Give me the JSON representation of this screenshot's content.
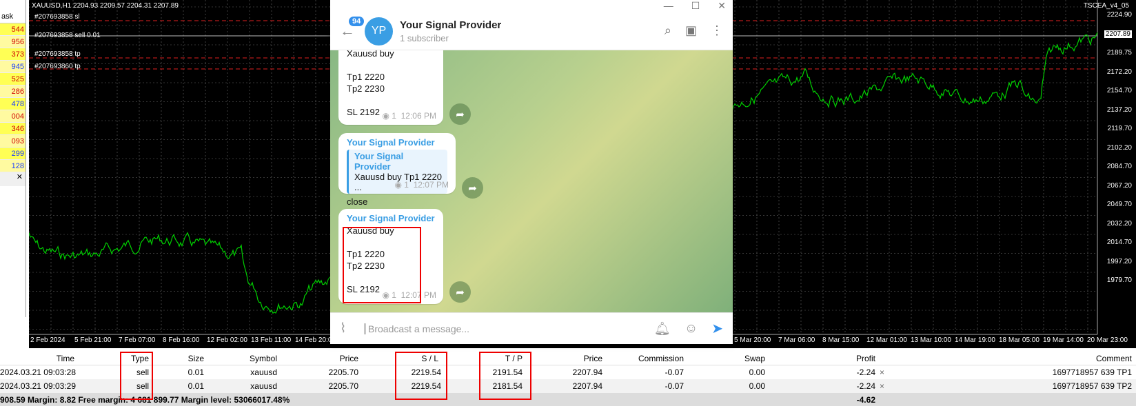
{
  "market_watch": {
    "header": "ask",
    "values": [
      "544",
      "956",
      "373",
      "945",
      "525",
      "286",
      "478",
      "004",
      "346",
      "093",
      "299",
      "128"
    ],
    "colors": [
      "#d10000",
      "#d10000",
      "#d10000",
      "#1a3cff",
      "#d10000",
      "#d10000",
      "#1a3cff",
      "#d10000",
      "#d10000",
      "#d10000",
      "#1a3cff",
      "#1a3cff"
    ]
  },
  "chart": {
    "title": "XAUUSD,H1  2204.93 2209.57 2204.31 2207.89",
    "ea_label": "TSCEA_v4_05",
    "order_lines": [
      "#207693858 sl",
      "#207693858 sell 0.01",
      "#207693858 tp",
      "#207693860 tp"
    ],
    "prices": [
      "2224.90",
      "2207.89",
      "2189.75",
      "2172.20",
      "2154.70",
      "2137.20",
      "2119.70",
      "2102.20",
      "2084.70",
      "2067.20",
      "2049.70",
      "2032.20",
      "2014.70",
      "1997.20",
      "1979.70"
    ],
    "dates_left": [
      "2 Feb 2024",
      "5 Feb 21:00",
      "7 Feb 07:00",
      "8 Feb 16:00",
      "12 Feb 02:00",
      "13 Feb 11:00",
      "14 Feb 20:00"
    ],
    "dates_right": [
      "5 Mar 20:00",
      "7 Mar 06:00",
      "8 Mar 15:00",
      "12 Mar 01:00",
      "13 Mar 10:00",
      "14 Mar 19:00",
      "18 Mar 05:00",
      "19 Mar 14:00",
      "20 Mar 23:00"
    ]
  },
  "telegram": {
    "badge": "94",
    "avatar": "YP",
    "channel_name": "Your Signal Provider",
    "subscribers": "1 subscriber",
    "input_placeholder": "Broadcast a message...",
    "msg1": {
      "lines": [
        "Xauusd buy",
        "",
        "Tp1 2220",
        "Tp2 2230",
        "",
        "SL 2192"
      ],
      "views": "1",
      "time": "12:06 PM"
    },
    "msg2": {
      "sender": "Your Signal Provider",
      "quote_name": "Your Signal Provider",
      "quote_text": "Xauusd buy  Tp1 2220 ...",
      "text": "close",
      "views": "1",
      "time": "12:07 PM"
    },
    "msg3": {
      "sender": "Your Signal Provider",
      "lines": [
        "Xauusd buy",
        "",
        "Tp1 2220",
        "Tp2 2230",
        "",
        "SL 2192"
      ],
      "views": "1",
      "time": "12:07 PM"
    }
  },
  "terminal": {
    "headers": {
      "time": "Time",
      "type": "Type",
      "size": "Size",
      "symbol": "Symbol",
      "price": "Price",
      "sl": "S / L",
      "tp": "T / P",
      "price2": "Price",
      "commission": "Commission",
      "swap": "Swap",
      "profit": "Profit",
      "comment": "Comment"
    },
    "rows": [
      {
        "time": "2024.03.21 09:03:28",
        "type": "sell",
        "size": "0.01",
        "symbol": "xauusd",
        "price": "2205.70",
        "sl": "2219.54",
        "tp": "2191.54",
        "price2": "2207.94",
        "commission": "-0.07",
        "swap": "0.00",
        "profit": "-2.24",
        "close": "×",
        "comment": "1697718957 639 TP1"
      },
      {
        "time": "2024.03.21 09:03:29",
        "type": "sell",
        "size": "0.01",
        "symbol": "xauusd",
        "price": "2205.70",
        "sl": "2219.54",
        "tp": "2181.54",
        "price2": "2207.94",
        "commission": "-0.07",
        "swap": "0.00",
        "profit": "-2.24",
        "close": "×",
        "comment": "1697718957 639 TP2"
      }
    ],
    "footer": {
      "summary": "908.59  Margin: 8.82  Free margin: 4 681 899.77  Margin level: 53066017.48%",
      "total": "-4.62"
    }
  }
}
